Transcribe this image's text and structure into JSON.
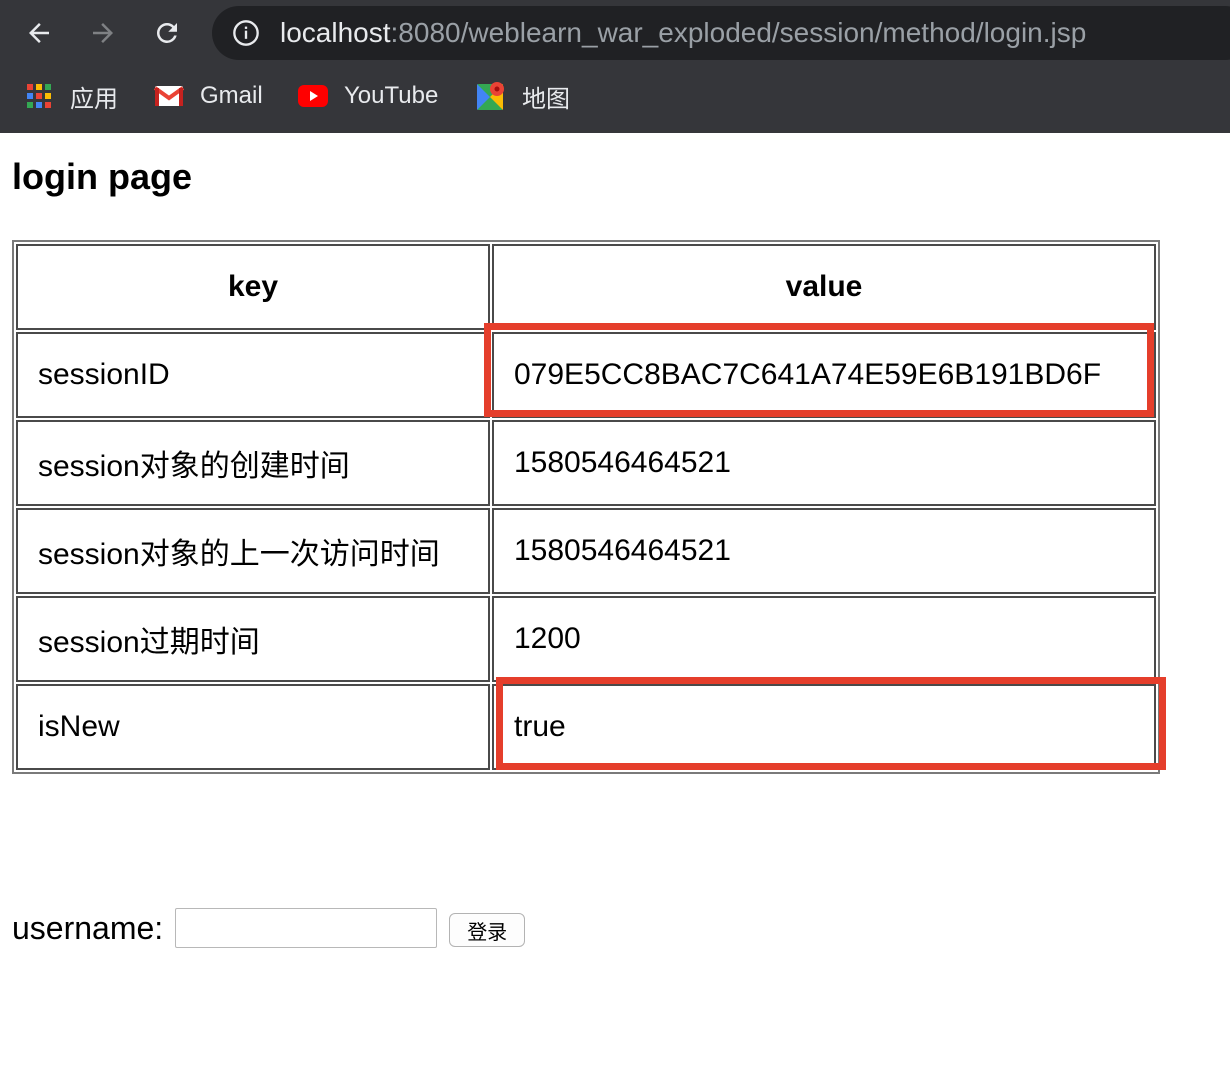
{
  "browser": {
    "address_bar": {
      "url_host": "localhost",
      "url_path": ":8080/weblearn_war_exploded/session/method/login.jsp"
    },
    "bookmarks": [
      {
        "label": "应用",
        "icon": "apps-grid-icon"
      },
      {
        "label": "Gmail",
        "icon": "gmail-icon"
      },
      {
        "label": "YouTube",
        "icon": "youtube-icon"
      },
      {
        "label": "地图",
        "icon": "maps-icon"
      }
    ]
  },
  "page": {
    "title": "login page",
    "table": {
      "headers": [
        "key",
        "value"
      ],
      "rows": [
        {
          "key": "sessionID",
          "value": "079E5CC8BAC7C641A74E59E6B191BD6F"
        },
        {
          "key": "session对象的创建时间",
          "value": "1580546464521"
        },
        {
          "key": "session对象的上一次访问时间",
          "value": "1580546464521"
        },
        {
          "key": "session过期时间",
          "value": "1200"
        },
        {
          "key": "isNew",
          "value": "true"
        }
      ]
    },
    "form": {
      "username_label": "username:",
      "username_value": "",
      "submit_label": "登录"
    }
  },
  "colors": {
    "chrome_bg": "#35363a",
    "omnibox_bg": "#202124",
    "highlight": "#e53e2b"
  }
}
